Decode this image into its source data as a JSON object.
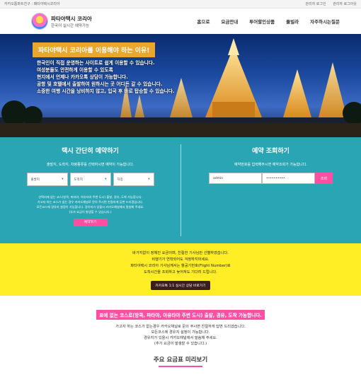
{
  "topbar": {
    "breadcrumb": "카카오톱파트친구 : 패타야택시코리아",
    "links": [
      "관리자 로그인",
      "관리자 로그아웃"
    ]
  },
  "header": {
    "logo_title": "파타야택시 코리아",
    "logo_subtitle": "한국어 실시간 예약가능",
    "nav": [
      "홈으로",
      "요금안내",
      "투어할인상품",
      "풀빌라",
      "자주하시는질문"
    ]
  },
  "hero": {
    "title": "파타야택시 코리아를 이용해야 하는 이유!",
    "lines": [
      "한국인이 직접 운영하는 사이트로 쉽게 이용할 수 있습니다.",
      "여성분들도 안전하게 이용할 수 있도록",
      "현지에서 언제나 카카오톡 상담이 가능합니다.",
      "공항 및 호텔에서 출발하여 원하시는 곳 어디든 갈 수 있습니다.",
      "소중한 여행 시간을 낭비하지 않고, 입국 후 바로 탑승할 수 있습니다."
    ]
  },
  "booking": {
    "title": "택시 간단히 예약하기",
    "subtitle": "출발지, 도착지, 차량종류를 선택하시면 예약이 가능합니다.",
    "selects": [
      "출발지",
      "도착지",
      "차종"
    ],
    "notice": [
      "선택지에 없는 코스(방콕, 파타야, 아유타야 주변 도시) 출발, 경유, 도착 가능합니다.",
      "가고자 하는 코스가 없는 경우 카카오채널로 문의 주시면 친절하게 답변 드리겠습니다.",
      "모든코스에 경유지 설정이 가능합니다. 경유지가 있을시 카카오채널에서 말씀해 주세요.",
      "(추가 요금이 발생할 수 있습니다.)"
    ],
    "button": "예약하기"
  },
  "lookup": {
    "title": "예약 조회하기",
    "subtitle": "예약번호를 입력해주시면 예약조회가 가능합니다.",
    "id_value": "admin",
    "pw_value": "••••••••••",
    "button": "조회"
  },
  "kakao": {
    "lines": [
      "바가지없이 정해진 요금이며, 친절한 기사님만 선별하였습니다.",
      "비행기가 연착되어도 걱정하지마세요.",
      "파타야택시 코리아 기사님께서는 항공기번호(Flight Number)로",
      "도착시간을 조회하고 늦어져도 기다려 드립니다."
    ],
    "button": "카카오톡 1:1 실시간 상담 바로가기"
  },
  "route": {
    "highlight": "표에 없는 코스로(방콕, 파타야, 아유타야 주변 도시) 출발, 경유, 도착 가능합니다.",
    "lines": [
      "가고자 하는 코스가 없는경우 카카오채널로 문의 주시면 친절하게 답변 드리겠습니다.",
      "모든코스에 경유지 설정이 가능합니다.",
      "경유지가 있을시 카카오채널에서 말씀해 주세요.",
      "(추가 요금이 발생할 수 있습니다.)"
    ],
    "fare_title": "주요 요금표 미리보기"
  },
  "colors": {
    "teal": "#2aa5b3",
    "pink": "#ff4fa3",
    "yellow": "#ffee26",
    "orange": "#e9a72b"
  }
}
